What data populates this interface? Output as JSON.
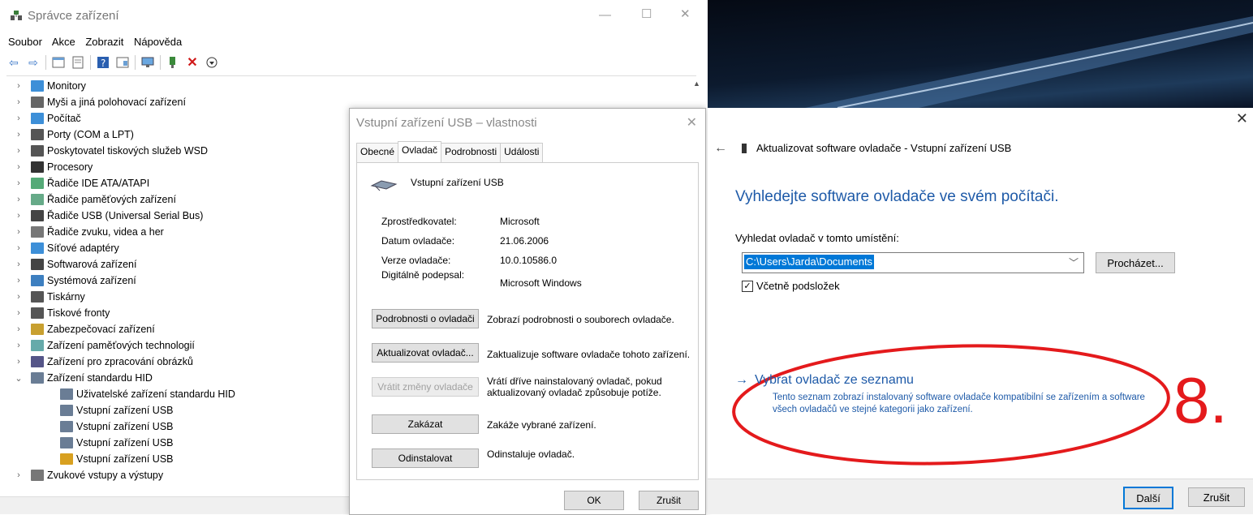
{
  "device_manager": {
    "title": "Správce zařízení",
    "menu": [
      "Soubor",
      "Akce",
      "Zobrazit",
      "Nápověda"
    ],
    "tree": [
      {
        "label": "Monitory",
        "expanded": false,
        "icon": "monitor-icon"
      },
      {
        "label": "Myši a jiná polohovací zařízení",
        "expanded": false,
        "icon": "mouse-icon"
      },
      {
        "label": "Počítač",
        "expanded": false,
        "icon": "computer-icon"
      },
      {
        "label": "Porty (COM a LPT)",
        "expanded": false,
        "icon": "port-icon"
      },
      {
        "label": "Poskytovatel tiskových služeb WSD",
        "expanded": false,
        "icon": "printer-icon"
      },
      {
        "label": "Procesory",
        "expanded": false,
        "icon": "cpu-icon"
      },
      {
        "label": "Řadiče IDE ATA/ATAPI",
        "expanded": false,
        "icon": "ide-icon"
      },
      {
        "label": "Řadiče paměťových zařízení",
        "expanded": false,
        "icon": "storage-icon"
      },
      {
        "label": "Řadiče USB (Universal Serial Bus)",
        "expanded": false,
        "icon": "usb-icon"
      },
      {
        "label": "Řadiče zvuku, videa a her",
        "expanded": false,
        "icon": "speaker-icon"
      },
      {
        "label": "Síťové adaptéry",
        "expanded": false,
        "icon": "network-icon"
      },
      {
        "label": "Softwarová zařízení",
        "expanded": false,
        "icon": "software-device-icon"
      },
      {
        "label": "Systémová zařízení",
        "expanded": false,
        "icon": "system-folder-icon"
      },
      {
        "label": "Tiskárny",
        "expanded": false,
        "icon": "printer-icon"
      },
      {
        "label": "Tiskové fronty",
        "expanded": false,
        "icon": "printer-icon"
      },
      {
        "label": "Zabezpečovací zařízení",
        "expanded": false,
        "icon": "security-key-icon"
      },
      {
        "label": "Zařízení paměťových technologií",
        "expanded": false,
        "icon": "memory-icon"
      },
      {
        "label": "Zařízení pro zpracování obrázků",
        "expanded": false,
        "icon": "camera-icon"
      },
      {
        "label": "Zařízení standardu HID",
        "expanded": true,
        "icon": "hid-icon"
      },
      {
        "label": "Uživatelské zařízení standardu HID",
        "child": true,
        "icon": "hid-icon"
      },
      {
        "label": "Vstupní zařízení USB",
        "child": true,
        "icon": "hid-icon"
      },
      {
        "label": "Vstupní zařízení USB",
        "child": true,
        "icon": "hid-icon"
      },
      {
        "label": "Vstupní zařízení USB",
        "child": true,
        "icon": "hid-icon"
      },
      {
        "label": "Vstupní zařízení USB",
        "child": true,
        "icon": "hid-warning-icon"
      },
      {
        "label": "Zvukové vstupy a výstupy",
        "expanded": false,
        "icon": "speaker-icon"
      }
    ]
  },
  "properties": {
    "title": "Vstupní zařízení USB – vlastnosti",
    "tabs": [
      "Obecné",
      "Ovladač",
      "Podrobnosti",
      "Události"
    ],
    "device_name": "Vstupní zařízení USB",
    "fields": [
      {
        "label": "Zprostředkovatel:",
        "value": "Microsoft"
      },
      {
        "label": "Datum ovladače:",
        "value": "21.06.2006"
      },
      {
        "label": "Verze ovladače:",
        "value": "10.0.10586.0"
      },
      {
        "label": "Digitálně podepsal:",
        "value": "Microsoft Windows"
      }
    ],
    "actions": [
      {
        "button": "Podrobnosti o ovladači",
        "desc": "Zobrazí podrobnosti o souborech ovladače."
      },
      {
        "button": "Aktualizovat ovladač...",
        "desc": "Zaktualizuje software ovladače tohoto zařízení."
      },
      {
        "button": "Vrátit změny ovladače",
        "desc": "Vrátí dříve nainstalovaný ovladač, pokud aktualizovaný ovladač způsobuje potíže."
      },
      {
        "button": "Zakázat",
        "desc": "Zakáže vybrané zařízení."
      },
      {
        "button": "Odinstalovat",
        "desc": "Odinstaluje ovladač."
      }
    ],
    "ok": "OK",
    "cancel": "Zrušit"
  },
  "wizard": {
    "header": "Aktualizovat software ovladače - Vstupní zařízení USB",
    "heading": "Vyhledejte software ovladače ve svém počítači.",
    "path_label": "Vyhledat ovladač v tomto umístění:",
    "path_value": "C:\\Users\\Jarda\\Documents",
    "browse": "Procházet...",
    "include_subfolders": "Včetně podsložek",
    "link_arrow": "→",
    "link": "Vybrat ovladač ze seznamu",
    "link_desc": "Tento seznam zobrazí instalovaný software ovladače kompatibilní se zařízením a software všech ovladačů ve stejné kategorii jako zařízení.",
    "annotation": "8.",
    "next": "Další",
    "cancel": "Zrušit"
  },
  "colors": {
    "accent": "#1e5aa8",
    "annotation_red": "#e41a1c",
    "selection": "#0078d7"
  }
}
